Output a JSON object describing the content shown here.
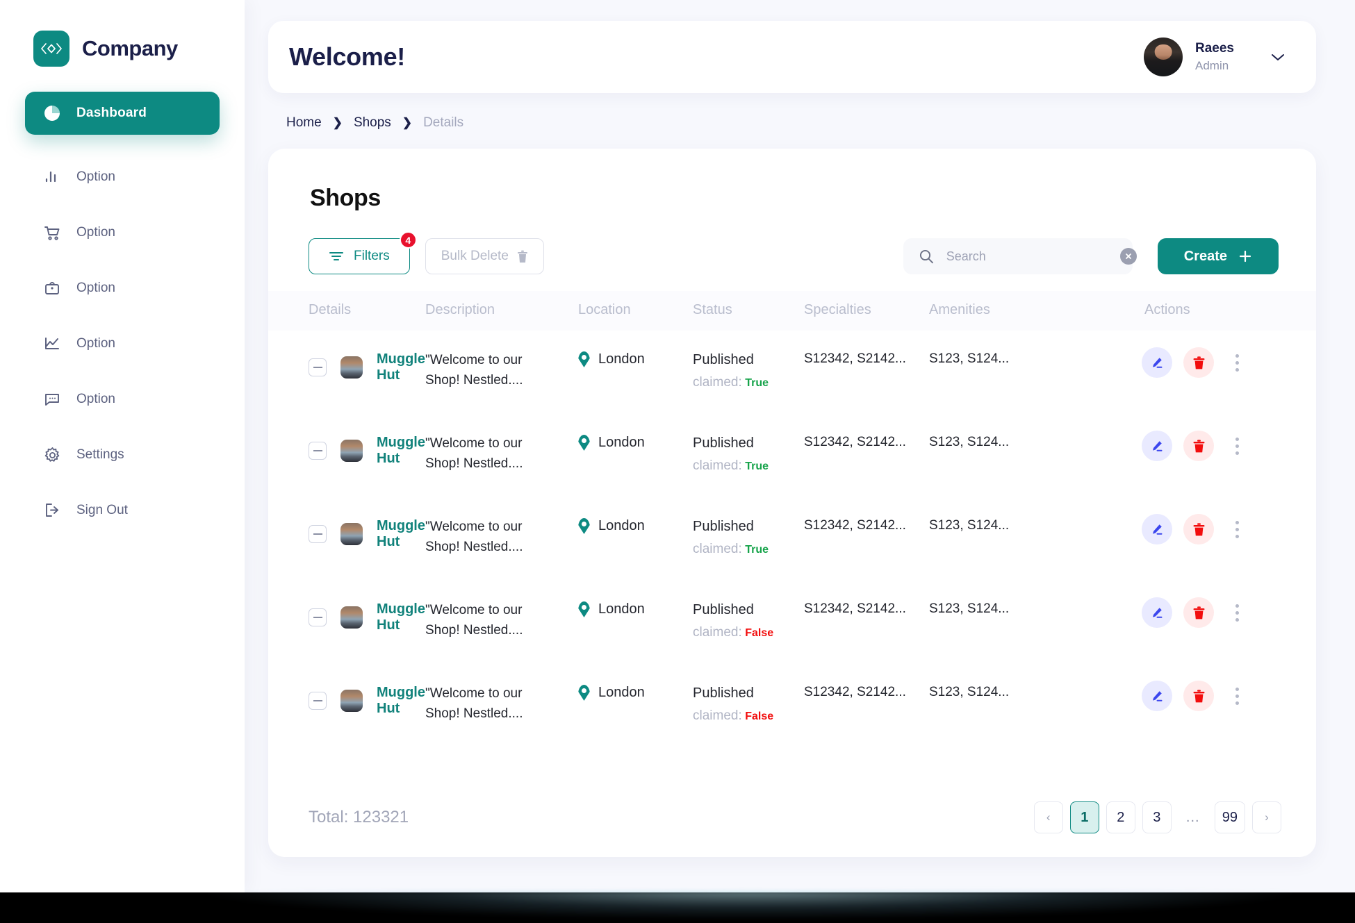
{
  "brand": {
    "name": "Company",
    "logo_icon": "code-brackets-icon"
  },
  "sidebar": {
    "items": [
      {
        "label": "Dashboard",
        "icon": "pie-chart-icon",
        "active": true
      },
      {
        "label": "Option",
        "icon": "bar-chart-icon",
        "active": false
      },
      {
        "label": "Option",
        "icon": "shopping-cart-icon",
        "active": false
      },
      {
        "label": "Option",
        "icon": "briefcase-icon",
        "active": false
      },
      {
        "label": "Option",
        "icon": "line-chart-icon",
        "active": false
      },
      {
        "label": "Option",
        "icon": "chat-bubble-icon",
        "active": false
      },
      {
        "label": "Settings",
        "icon": "gear-icon",
        "active": false
      },
      {
        "label": "Sign Out",
        "icon": "logout-icon",
        "active": false
      }
    ]
  },
  "header": {
    "title": "Welcome!",
    "user_name": "Raees",
    "user_role": "Admin",
    "chevron": "▾"
  },
  "breadcrumb": {
    "items": [
      "Home",
      "Shops",
      "Details"
    ],
    "separator": "❯"
  },
  "panel": {
    "title": "Shops",
    "toolbar": {
      "filters_label": "Filters",
      "filters_badge": "4",
      "bulk_delete_label": "Bulk Delete",
      "create_label": "Create",
      "create_plus": "+"
    },
    "search": {
      "placeholder": "Search",
      "value": ""
    },
    "columns": [
      "Details",
      "Description",
      "Location",
      "Status",
      "Specialties",
      "Amenities",
      "Actions"
    ],
    "rows": [
      {
        "name": "Muggle Hut",
        "description_line1": "\"Welcome to our",
        "description_line2": "Shop! Nestled....",
        "location": "London",
        "status": "Published",
        "claimed_label": "claimed:",
        "claimed_value": "True",
        "specialties": "S12342, S2142...",
        "amenities": "S123, S124..."
      },
      {
        "name": "Muggle Hut",
        "description_line1": "\"Welcome to our",
        "description_line2": "Shop! Nestled....",
        "location": "London",
        "status": "Published",
        "claimed_label": "claimed:",
        "claimed_value": "True",
        "specialties": "S12342, S2142...",
        "amenities": "S123, S124..."
      },
      {
        "name": "Muggle Hut",
        "description_line1": "\"Welcome to our",
        "description_line2": "Shop! Nestled....",
        "location": "London",
        "status": "Published",
        "claimed_label": "claimed:",
        "claimed_value": "True",
        "specialties": "S12342, S2142...",
        "amenities": "S123, S124..."
      },
      {
        "name": "Muggle Hut",
        "description_line1": "\"Welcome to our",
        "description_line2": "Shop! Nestled....",
        "location": "London",
        "status": "Published",
        "claimed_label": "claimed:",
        "claimed_value": "False",
        "specialties": "S12342, S2142...",
        "amenities": "S123, S124..."
      },
      {
        "name": "Muggle Hut",
        "description_line1": "\"Welcome to our",
        "description_line2": "Shop! Nestled....",
        "location": "London",
        "status": "Published",
        "claimed_label": "claimed:",
        "claimed_value": "False",
        "specialties": "S12342, S2142...",
        "amenities": "S123, S124..."
      }
    ],
    "footer": {
      "total": "Total: 123321",
      "pagination": {
        "prev": "‹",
        "next": "›",
        "pages": [
          "1",
          "2",
          "3",
          "...",
          "99"
        ],
        "current": "1"
      }
    }
  },
  "colors": {
    "accent_teal": "#0d8a82",
    "brand_navy": "#1b1f49",
    "true_green": "#16a34a",
    "false_red": "#f20d0d",
    "badge_red": "#e8112d",
    "edit_blue": "#3b46ee",
    "page_bg": "#f7f8fd"
  }
}
